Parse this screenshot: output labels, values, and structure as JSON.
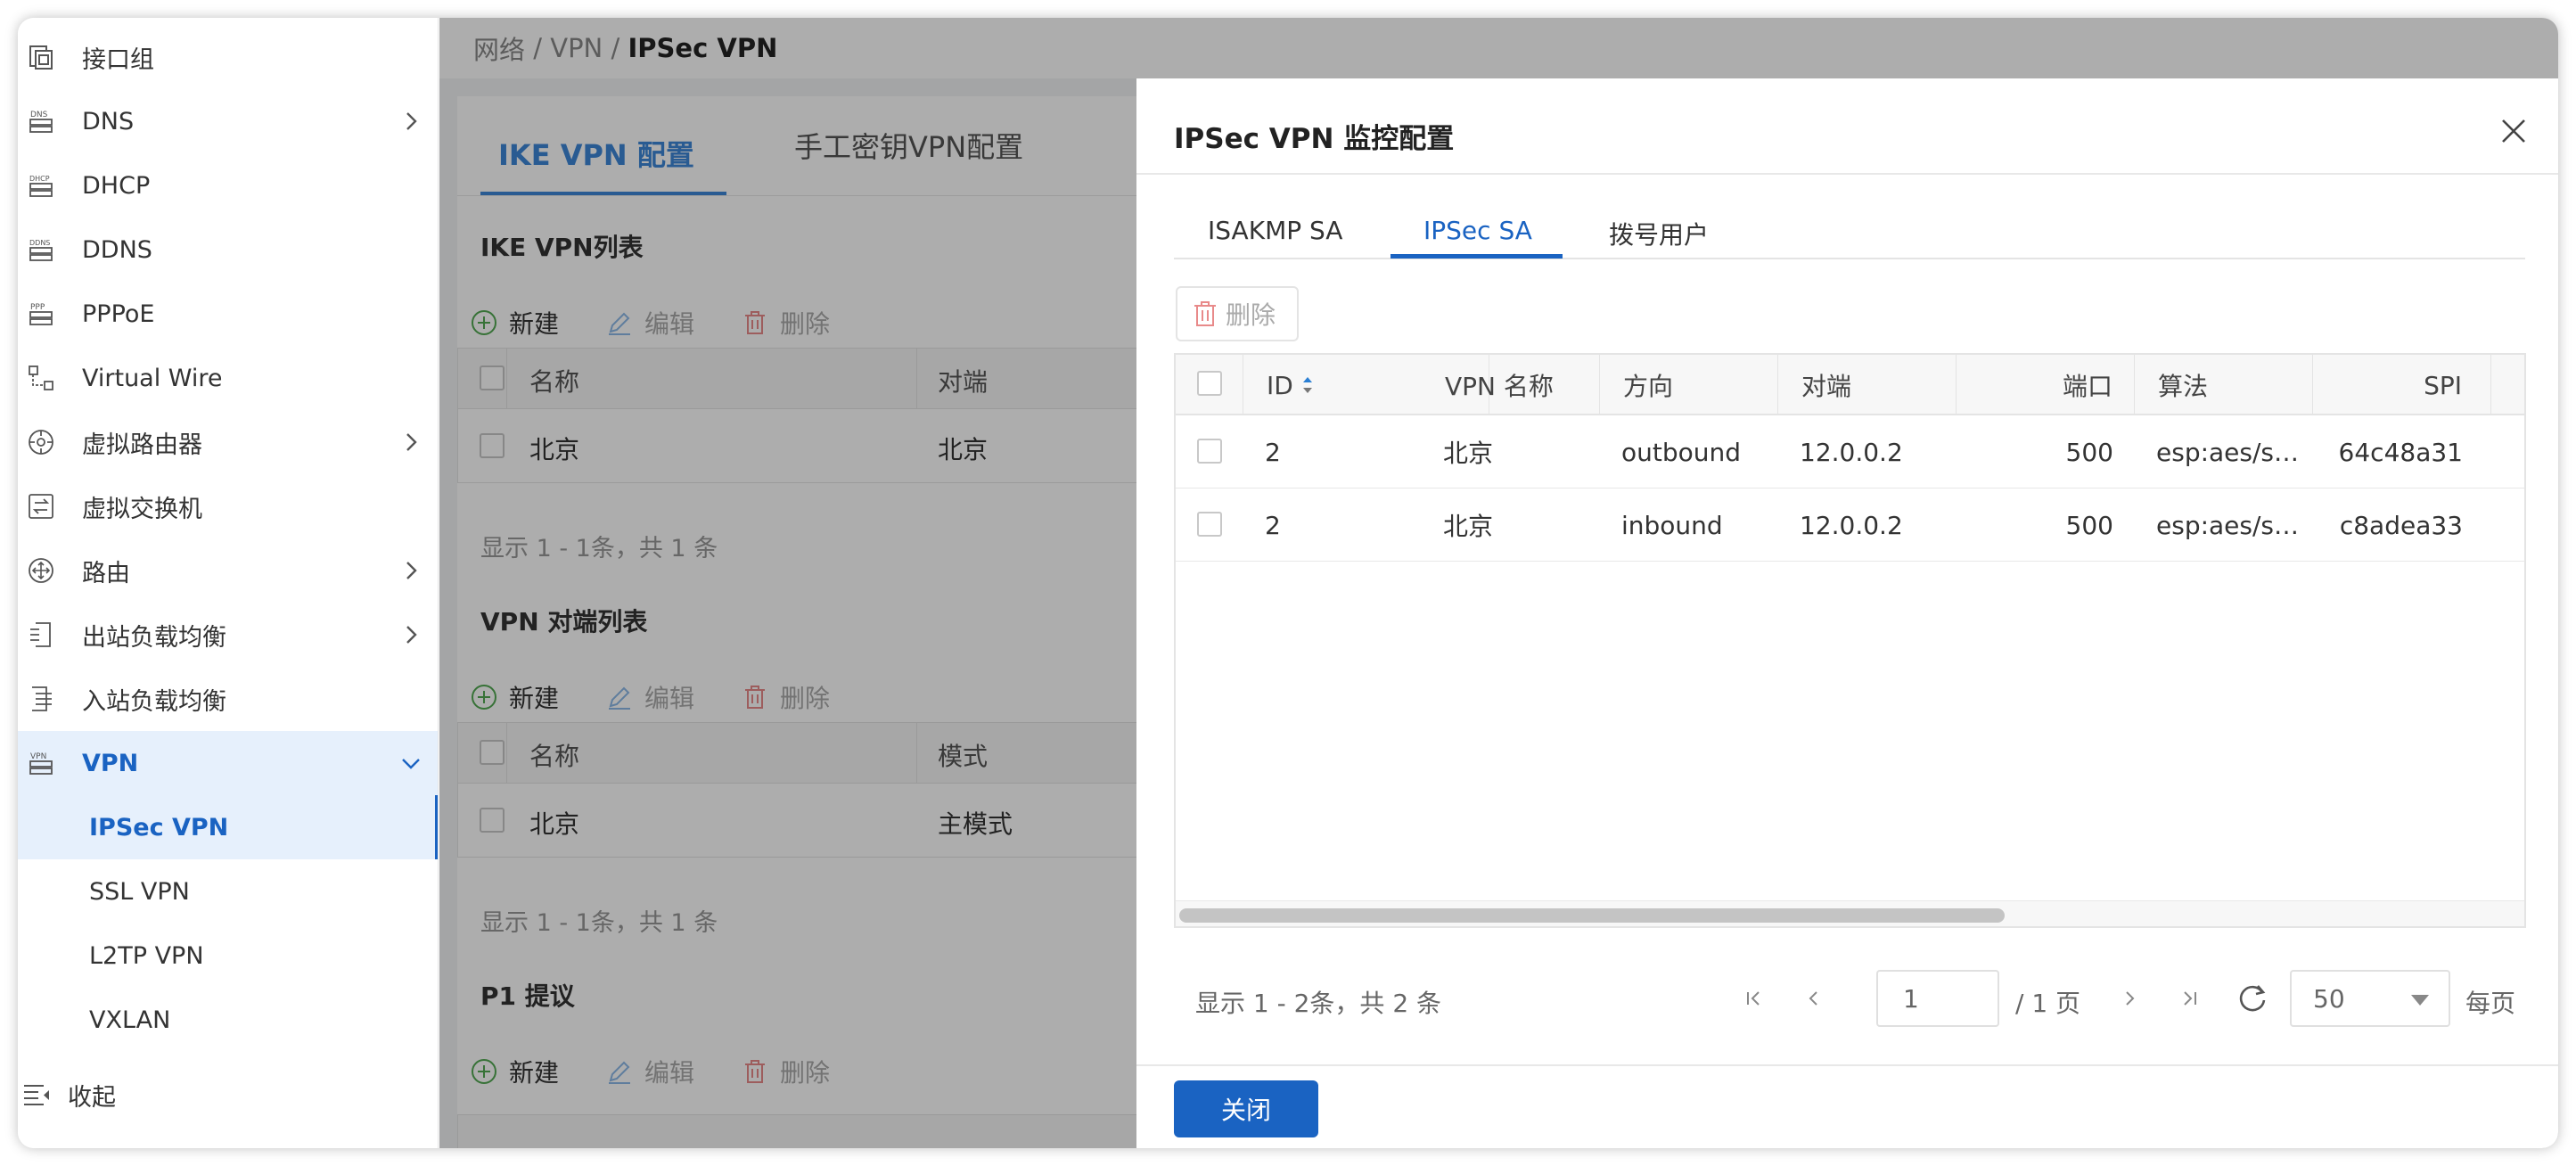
{
  "sidebar": {
    "items": [
      {
        "label": "接口组",
        "icon": "interface-group-icon"
      },
      {
        "label": "DNS",
        "icon": "dns-icon"
      },
      {
        "label": "DHCP",
        "icon": "dhcp-icon"
      },
      {
        "label": "DDNS",
        "icon": "ddns-icon"
      },
      {
        "label": "PPPoE",
        "icon": "pppoe-icon"
      },
      {
        "label": "Virtual Wire",
        "icon": "virtual-wire-icon"
      },
      {
        "label": "虚拟路由器",
        "icon": "virtual-router-icon"
      },
      {
        "label": "虚拟交换机",
        "icon": "virtual-switch-icon"
      },
      {
        "label": "路由",
        "icon": "route-icon"
      },
      {
        "label": "出站负载均衡",
        "icon": "outbound-lb-icon"
      },
      {
        "label": "入站负载均衡",
        "icon": "inbound-lb-icon"
      },
      {
        "label": "VPN",
        "icon": "vpn-icon"
      }
    ],
    "vpn_sub": [
      {
        "label": "IPSec VPN"
      },
      {
        "label": "SSL VPN"
      },
      {
        "label": "L2TP VPN"
      },
      {
        "label": "VXLAN"
      }
    ],
    "collapse_label": "收起"
  },
  "breadcrumb": {
    "part1": "网络",
    "sep": " / ",
    "part2": "VPN",
    "current": "IPSec VPN"
  },
  "page": {
    "tabs": [
      {
        "label": "IKE VPN 配置"
      },
      {
        "label": "手工密钥VPN配置"
      }
    ],
    "toolbar": {
      "new_label": "新建",
      "edit_label": "编辑",
      "delete_label": "删除"
    },
    "sections": [
      {
        "title": "IKE VPN列表",
        "columns": [
          "名称",
          "对端"
        ],
        "rows": [
          [
            "北京",
            "北京"
          ]
        ],
        "footer": "显示 1 - 1条，共 1 条"
      },
      {
        "title": "VPN 对端列表",
        "columns": [
          "名称",
          "模式"
        ],
        "rows": [
          [
            "北京",
            "主模式"
          ]
        ],
        "footer": "显示 1 - 1条，共 1 条"
      },
      {
        "title": "P1 提议"
      }
    ]
  },
  "drawer": {
    "title": "IPSec VPN 监控配置",
    "tabs": [
      {
        "label": "ISAKMP SA"
      },
      {
        "label": "IPSec SA"
      },
      {
        "label": "拨号用户"
      }
    ],
    "active_tab": "IPSec SA",
    "delete_label": "删除",
    "columns": [
      "ID",
      "VPN 名称",
      "方向",
      "对端",
      "端口",
      "算法",
      "SPI"
    ],
    "rows": [
      [
        "2",
        "北京",
        "outbound",
        "12.0.0.2",
        "500",
        "esp:aes/s…",
        "64c48a31"
      ],
      [
        "2",
        "北京",
        "inbound",
        "12.0.0.2",
        "500",
        "esp:aes/s…",
        "c8adea33"
      ]
    ],
    "pagination": {
      "info": "显示 1 - 2条，共 2 条",
      "page": "1",
      "total": "/ 1 页",
      "page_size": "50",
      "per_page": "每页"
    },
    "close_label": "关闭"
  },
  "colors": {
    "primary": "#1a63c2",
    "tab_active": "#3d86d8",
    "selected_bg": "#e6f0fc",
    "new_green": "#52a852",
    "edit_blue": "#8cb8e8",
    "delete_red": "#e88a8a"
  }
}
